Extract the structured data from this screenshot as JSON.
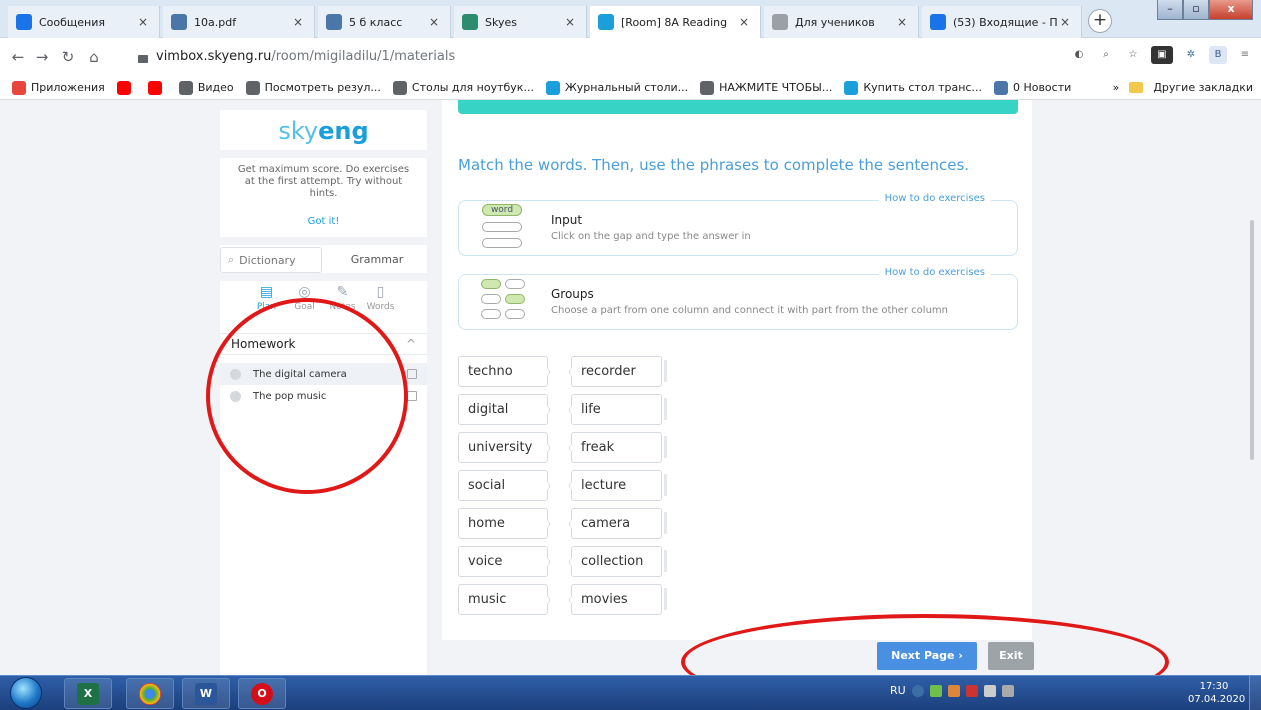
{
  "browser": {
    "tabs": [
      {
        "label": "Сообщения",
        "icon": "chat",
        "color": "#1a73e8"
      },
      {
        "label": "10a.pdf",
        "icon": "VK",
        "color": "#4a76a8"
      },
      {
        "label": "5 б класс",
        "icon": "VK",
        "color": "#4a76a8"
      },
      {
        "label": "Skyes",
        "icon": "S",
        "color": "#2d8c6e"
      },
      {
        "label": "[Room] 8А Reading",
        "icon": "S",
        "color": "#1a9fdb",
        "active": true
      },
      {
        "label": "Для учеников",
        "icon": "page",
        "color": "#9aa0a6"
      },
      {
        "label": "(53) Входящие - П",
        "icon": "mail",
        "color": "#1a73e8"
      }
    ],
    "close_glyph": "×",
    "newtab_glyph": "+",
    "url_host": "vimbox.skyeng.ru",
    "url_path": "/room/migiladilu/1/materials",
    "bookmarks": [
      {
        "label": "Приложения",
        "color": "#e8453c"
      },
      {
        "label": "",
        "color": "#ff0000"
      },
      {
        "label": "",
        "color": "#ff0000"
      },
      {
        "label": "Видео",
        "color": "#5f6368"
      },
      {
        "label": "Посмотреть резул...",
        "color": "#5f6368"
      },
      {
        "label": "Столы для ноутбук...",
        "color": "#5f6368"
      },
      {
        "label": "Журнальный столи...",
        "color": "#1a9fdb"
      },
      {
        "label": "НАЖМИТЕ ЧТОБЫ...",
        "color": "#5f6368"
      },
      {
        "label": "Купить стол транс...",
        "color": "#1a9fdb"
      },
      {
        "label": "0 Новости",
        "color": "#4a76a8"
      }
    ],
    "bookmarks_more": "»",
    "other_bookmarks": "Другие закладки"
  },
  "sidebar": {
    "logo_a": "sky",
    "logo_b": "eng",
    "hint": "Get maximum score. Do exercises at the first attempt. Try without hints.",
    "got_it": "Got it!",
    "dictionary_placeholder": "Dictionary",
    "grammar": "Grammar",
    "tabs": [
      {
        "label": "Plan",
        "glyph": "▤",
        "active": true
      },
      {
        "label": "Goal",
        "glyph": "◎"
      },
      {
        "label": "Notes",
        "glyph": "✎"
      },
      {
        "label": "Words",
        "glyph": "▯"
      }
    ],
    "homework_title": "Homework",
    "homework_chevron": "^",
    "lessons": [
      {
        "title": "The digital camera",
        "selected": true
      },
      {
        "title": "The pop music",
        "selected": false
      }
    ]
  },
  "exercise": {
    "instruction": "Match the words. Then, use the phrases to complete the sentences.",
    "how_link": "How to do exercises",
    "cards": [
      {
        "title": "Input",
        "desc": "Click on the gap and type the answer in",
        "badge": "word"
      },
      {
        "title": "Groups",
        "desc": "Choose a part from one column and connect it with part from the other column"
      }
    ],
    "left_words": [
      "techno",
      "digital",
      "university",
      "social",
      "home",
      "voice",
      "music"
    ],
    "right_words": [
      "recorder",
      "life",
      "freak",
      "lecture",
      "camera",
      "collection",
      "movies"
    ]
  },
  "footer": {
    "next": "Next Page  ›",
    "exit": "Exit"
  },
  "taskbar": {
    "lang": "RU",
    "time": "17:30",
    "date": "07.04.2020"
  },
  "colors": {
    "accent": "#4a90e2",
    "teal": "#37d4c5",
    "annotation": "#e01818"
  }
}
